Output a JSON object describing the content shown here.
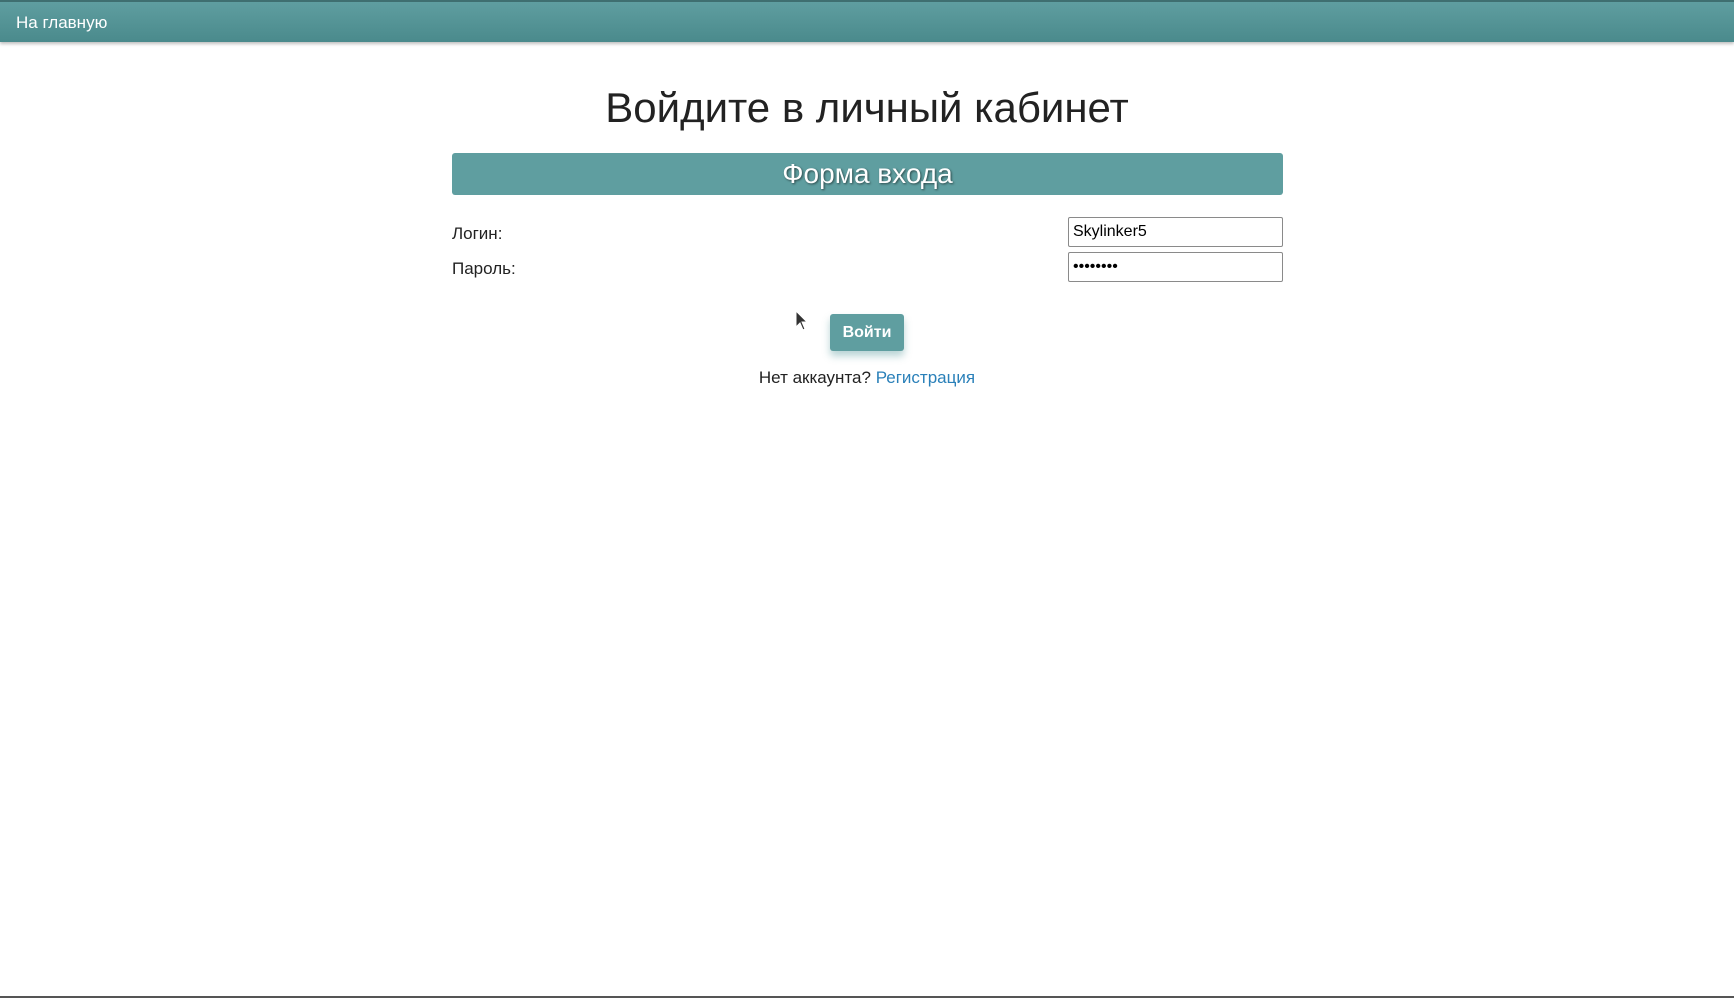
{
  "nav": {
    "home_label": "На главную"
  },
  "page": {
    "title": "Войдите в личный кабинет"
  },
  "form": {
    "header": "Форма входа",
    "login_label": "Логин:",
    "login_value": "Skylinker5",
    "password_label": "Пароль:",
    "password_value": "••••••••",
    "submit_label": "Войти"
  },
  "register": {
    "prompt": "Нет аккаунта?",
    "link_label": "Регистрация"
  },
  "colors": {
    "accent": "#5f9ea0",
    "link": "#2a80b9"
  },
  "icons": {
    "cursor": "mouse-cursor-icon"
  }
}
